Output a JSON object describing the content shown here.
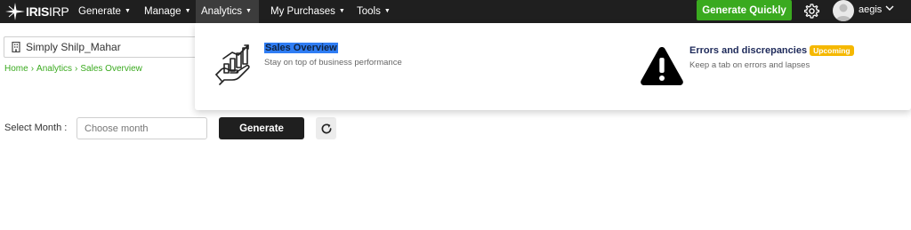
{
  "brand": {
    "logo_bold": "IRIS",
    "logo_light": "IRP"
  },
  "nav": {
    "items": [
      {
        "label": "Generate"
      },
      {
        "label": "Manage"
      },
      {
        "label": "Analytics"
      },
      {
        "label": "My Purchases"
      },
      {
        "label": "Tools"
      }
    ],
    "active": "Analytics",
    "generate_quickly": "Generate Quickly",
    "user_name": "aegis"
  },
  "company": {
    "name": "Simply Shilp_Mahar"
  },
  "breadcrumb": [
    "Home",
    "Analytics",
    "Sales Overview"
  ],
  "form": {
    "month_label": "Select Month :",
    "month_placeholder": "Choose month",
    "generate_label": "Generate"
  },
  "analytics_menu": {
    "sales": {
      "title": "Sales Overview",
      "desc": "Stay on top of business performance"
    },
    "errors": {
      "title": "Errors and discrepancies",
      "badge": "Upcoming",
      "desc": "Keep a tab on errors and lapses"
    }
  },
  "colors": {
    "navbar": "#1f1f1f",
    "accent_green": "#3aaa1f",
    "badge_yellow": "#f5b800",
    "selection_blue": "#2f7df4"
  },
  "icons": {
    "logo": "iris-star-logo",
    "settings": "gear-icon",
    "user": "avatar",
    "company": "building-icon",
    "refresh": "refresh-icon",
    "sales": "hand-chart-icon",
    "errors": "warning-triangle-icon"
  }
}
